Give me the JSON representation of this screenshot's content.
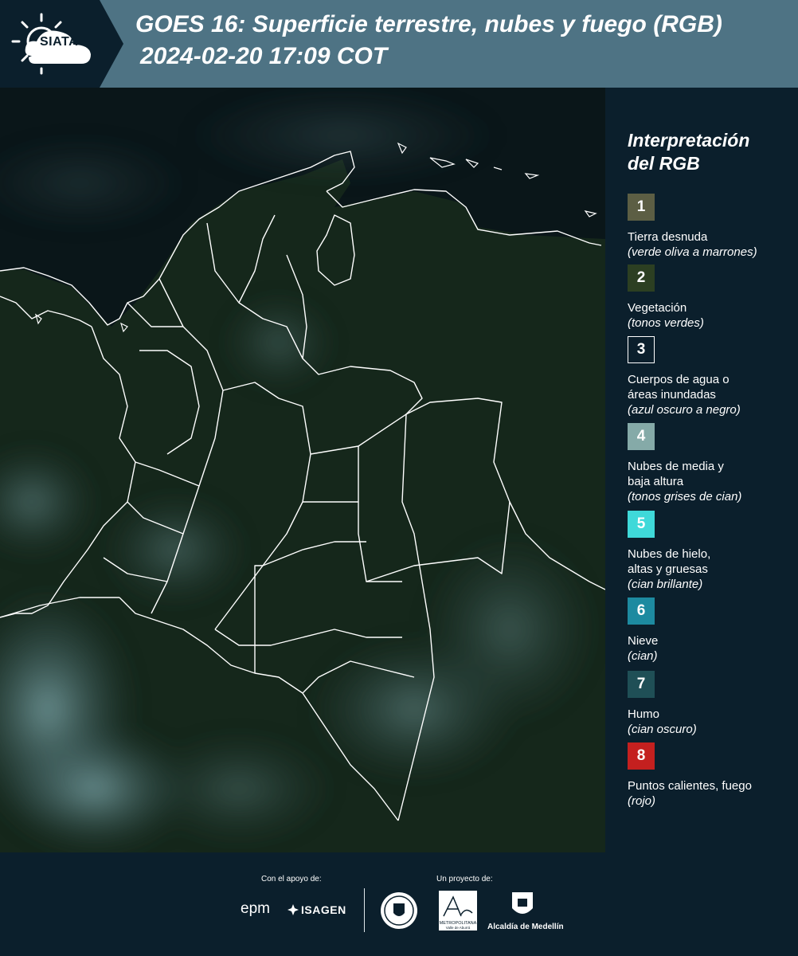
{
  "header": {
    "logo_text": "SIATA",
    "title": "GOES 16: Superficie terrestre, nubes y fuego (RGB)",
    "subtitle": "2024-02-20 17:09 COT"
  },
  "legend": {
    "title_line1": "Interpretación",
    "title_line2": "del RGB",
    "items": [
      {
        "number": "1",
        "color": "#5c5e44",
        "lines": [
          "Tierra desnuda"
        ],
        "note": "(verde oliva a marrones)"
      },
      {
        "number": "2",
        "color": "#2c3f22",
        "lines": [
          "Vegetación"
        ],
        "note": "(tonos verdes)"
      },
      {
        "number": "3",
        "color": "#0b1f2c",
        "lines": [
          "Cuerpos de agua o",
          "áreas inundadas"
        ],
        "note": "(azul oscuro a negro)"
      },
      {
        "number": "4",
        "color": "#85aaa8",
        "lines": [
          "Nubes de media y",
          "baja altura"
        ],
        "note": "(tonos grises de cian)"
      },
      {
        "number": "5",
        "color": "#3fd9d9",
        "lines": [
          "Nubes de hielo,",
          "altas y gruesas"
        ],
        "note": "(cian brillante)"
      },
      {
        "number": "6",
        "color": "#1d8aa0",
        "lines": [
          "Nieve"
        ],
        "note": "(cian)"
      },
      {
        "number": "7",
        "color": "#1f4f56",
        "lines": [
          "Humo"
        ],
        "note": "(cian oscuro)"
      },
      {
        "number": "8",
        "color": "#c4201f",
        "lines": [
          "Puntos calientes, fuego"
        ],
        "note": "(rojo)"
      }
    ]
  },
  "footer": {
    "support_label": "Con el apoyo de:",
    "project_label": "Un proyecto de:",
    "logo_epm": "epm",
    "logo_isagen": "ISAGEN",
    "logo_area_line1": "METROPOLITANA",
    "logo_area_line2": "Valle de Aburrá",
    "logo_alcaldia": "Alcaldía de Medellín"
  },
  "map": {
    "land_color": "#16271c",
    "cloud_color": "#5f8a8d",
    "border_color": "#ffffff"
  }
}
